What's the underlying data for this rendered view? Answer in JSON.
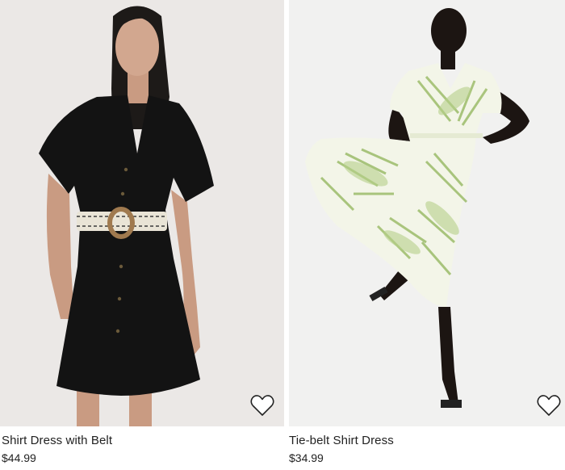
{
  "products": [
    {
      "name": "Shirt Dress with Belt",
      "price": "$44.99",
      "image_desc_icon": "product-photo",
      "favorite_icon": "heart-outline-icon"
    },
    {
      "name": "Tie-belt Shirt Dress",
      "price": "$34.99",
      "image_desc_icon": "product-photo",
      "favorite_icon": "heart-outline-icon"
    }
  ],
  "colors": {
    "text": "#222222",
    "left_bg": "#ebe8e6",
    "right_bg": "#f1f1f0",
    "heart_fill": "#ffffff"
  }
}
